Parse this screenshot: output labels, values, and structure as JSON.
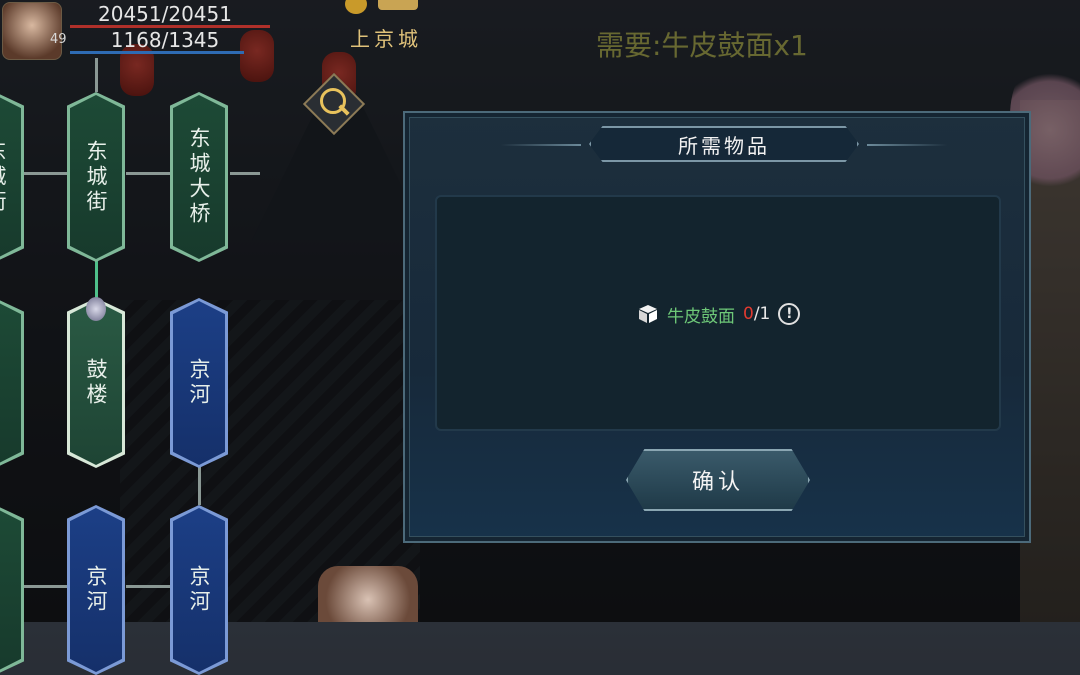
{
  "hud": {
    "hp": "20451/20451",
    "mp": "1168/1345",
    "level": "49",
    "hp_fraction": 1.0,
    "mp_fraction": 0.868
  },
  "location": {
    "name": "上京城"
  },
  "quest_hint": "需要:牛皮鼓面x1",
  "map_nodes": {
    "west_top": "东城街",
    "west_top_partial": "东城街",
    "east_top": "东城大桥",
    "active": "鼓楼",
    "river_mid": "京河",
    "river_bottom_left": "京河",
    "river_bottom_right": "京河"
  },
  "modal": {
    "title": "所需物品",
    "item": {
      "icon": "box-icon",
      "name": "牛皮鼓面",
      "have": "0",
      "need": "/1",
      "info_icon": "info-icon"
    },
    "confirm_label": "确认"
  },
  "colors": {
    "item_name": "#6ec878",
    "qty_missing": "#e03a30",
    "node_green": "#1d4a36",
    "node_blue": "#1c3f86"
  }
}
